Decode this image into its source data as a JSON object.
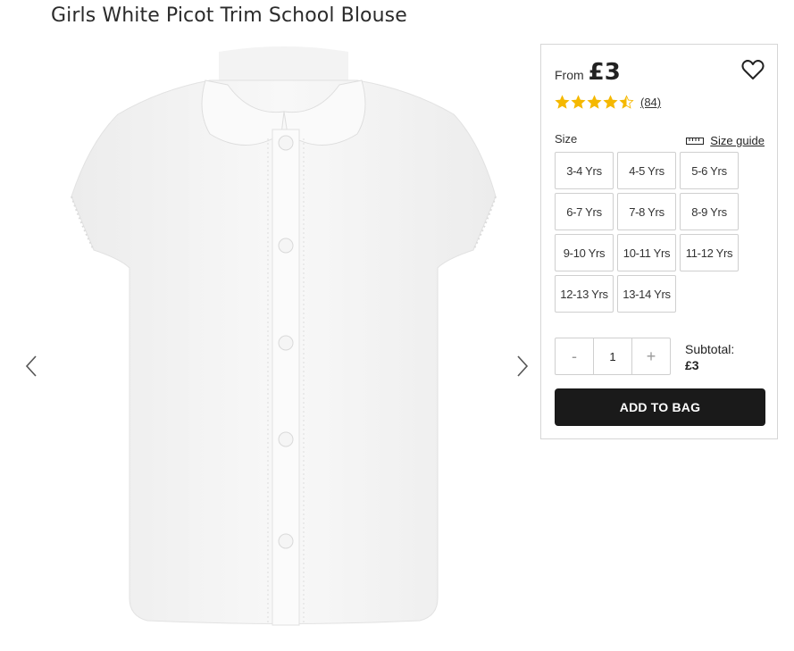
{
  "product": {
    "title": "Girls White Picot Trim School Blouse"
  },
  "gallery": {
    "prev_icon": "chevron-left-icon",
    "next_icon": "chevron-right-icon",
    "image": "white-school-blouse"
  },
  "purchase": {
    "from_label": "From",
    "price": "£3",
    "wishlist_icon": "heart-icon",
    "rating": {
      "stars": 4.5,
      "max": 5,
      "count": "(84)",
      "star_color": "#f5b800"
    },
    "size_label": "Size",
    "size_guide_label": "Size guide",
    "size_guide_icon": "ruler-icon",
    "sizes": [
      "3-4 Yrs",
      "4-5 Yrs",
      "5-6 Yrs",
      "6-7 Yrs",
      "7-8 Yrs",
      "8-9 Yrs",
      "9-10 Yrs",
      "10-11 Yrs",
      "11-12 Yrs",
      "12-13 Yrs",
      "13-14 Yrs"
    ],
    "quantity": {
      "minus": "-",
      "value": "1",
      "plus": "+"
    },
    "subtotal_label": "Subtotal:",
    "subtotal_amount": "£3",
    "add_to_bag_label": "ADD TO BAG",
    "add_button_color": "#1a1a1a"
  }
}
